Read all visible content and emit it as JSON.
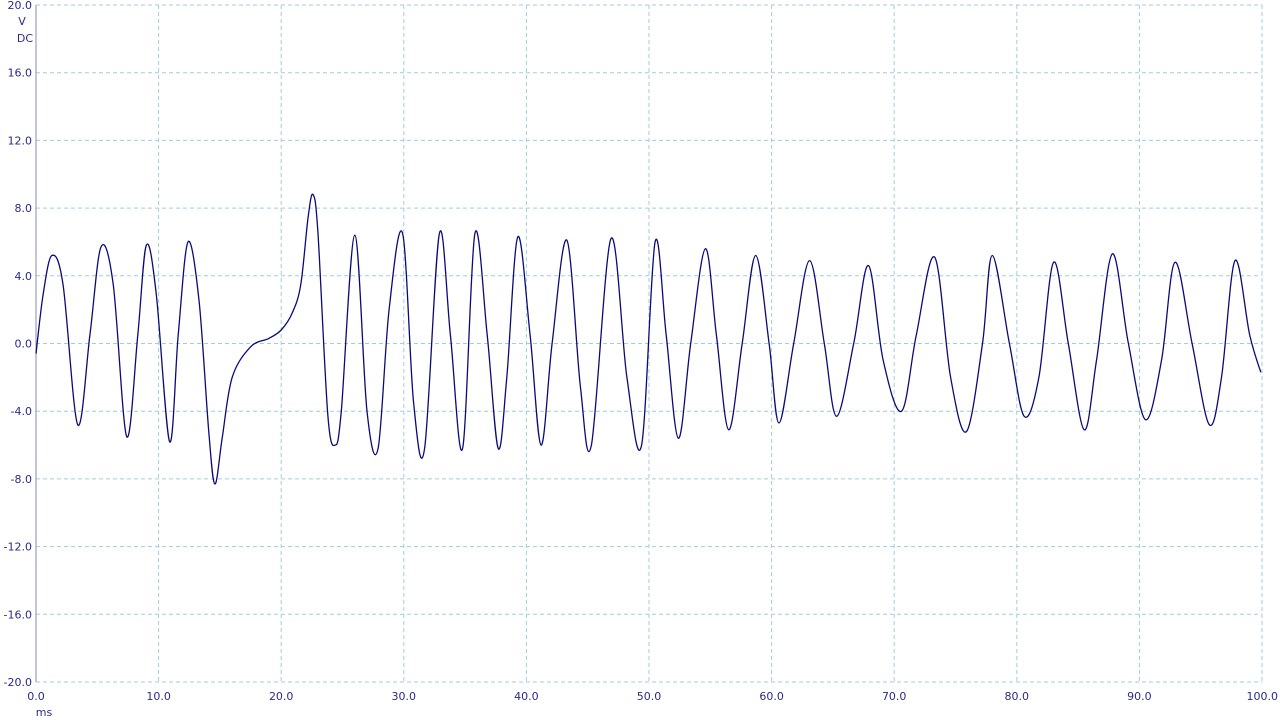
{
  "chart_data": {
    "type": "line",
    "title": "",
    "xlabel": "ms",
    "ylabel": "V",
    "coupling": "DC",
    "xlim": [
      0,
      100
    ],
    "ylim": [
      -20,
      20
    ],
    "grid": true,
    "x_ticks": [
      "0.0",
      "10.0",
      "20.0",
      "30.0",
      "40.0",
      "50.0",
      "60.0",
      "70.0",
      "80.0",
      "90.0",
      "100.0"
    ],
    "y_ticks": [
      "20.0",
      "16.0",
      "12.0",
      "8.0",
      "4.0",
      "0.0",
      "-4.0",
      "-8.0",
      "-12.0",
      "-16.0",
      "-20.0"
    ],
    "colors": {
      "trace": "#0a0a78",
      "grid": "#9fcfd8",
      "text": "#2a2a8c"
    },
    "series": [
      {
        "name": "",
        "x": [
          0.0,
          0.6,
          1.3,
          2.2,
          3.4,
          4.4,
          5.3,
          6.3,
          7.4,
          8.3,
          9.0,
          9.8,
          10.9,
          11.6,
          12.4,
          13.3,
          14.1,
          14.6,
          15.2,
          16.0,
          17.5,
          19.0,
          20.0,
          20.9,
          21.6,
          22.2,
          22.6,
          23.0,
          23.8,
          24.4,
          24.9,
          26.0,
          27.0,
          27.9,
          28.8,
          29.9,
          30.8,
          31.7,
          32.9,
          33.8,
          34.8,
          35.8,
          36.8,
          37.7,
          38.4,
          39.3,
          40.3,
          41.2,
          42.1,
          43.3,
          44.4,
          45.3,
          46.9,
          48.2,
          49.4,
          50.5,
          51.4,
          52.4,
          53.4,
          54.6,
          55.5,
          56.5,
          57.6,
          58.7,
          59.8,
          60.6,
          61.8,
          63.1,
          64.3,
          65.3,
          66.7,
          67.9,
          69.1,
          70.6,
          71.8,
          73.3,
          74.6,
          75.9,
          77.2,
          78.0,
          79.4,
          80.6,
          81.8,
          83.0,
          84.2,
          85.5,
          86.5,
          87.8,
          89.1,
          90.5,
          91.8,
          92.9,
          94.3,
          95.7,
          96.7,
          97.8,
          99.0,
          99.9
        ],
        "y": [
          -0.6,
          3.0,
          5.2,
          3.5,
          -4.8,
          0.5,
          5.7,
          3.5,
          -5.5,
          0.5,
          5.8,
          3.0,
          -5.8,
          0.5,
          6.0,
          2.5,
          -5.3,
          -8.3,
          -5.5,
          -2.0,
          -0.2,
          0.3,
          0.8,
          1.8,
          3.5,
          7.5,
          8.8,
          6.5,
          -4.2,
          -6.0,
          -4.0,
          6.4,
          -4.0,
          -6.2,
          2.0,
          6.5,
          -3.5,
          -6.2,
          6.5,
          0.5,
          -6.2,
          6.5,
          0.5,
          -6.2,
          -2.0,
          6.3,
          0.5,
          -6.0,
          0.0,
          6.1,
          -2.5,
          -6.0,
          6.2,
          -2.0,
          -6.0,
          6.0,
          0.5,
          -5.6,
          0.0,
          5.6,
          0.5,
          -5.1,
          0.0,
          5.2,
          0.0,
          -4.7,
          0.0,
          4.9,
          0.0,
          -4.3,
          0.0,
          4.6,
          -1.0,
          -4.0,
          0.5,
          5.1,
          -2.0,
          -5.2,
          0.0,
          5.2,
          0.0,
          -4.3,
          -2.0,
          4.8,
          0.0,
          -5.1,
          -1.0,
          5.3,
          0.0,
          -4.5,
          -1.0,
          4.8,
          0.0,
          -4.8,
          -2.0,
          4.9,
          0.5,
          -1.7
        ]
      }
    ]
  }
}
